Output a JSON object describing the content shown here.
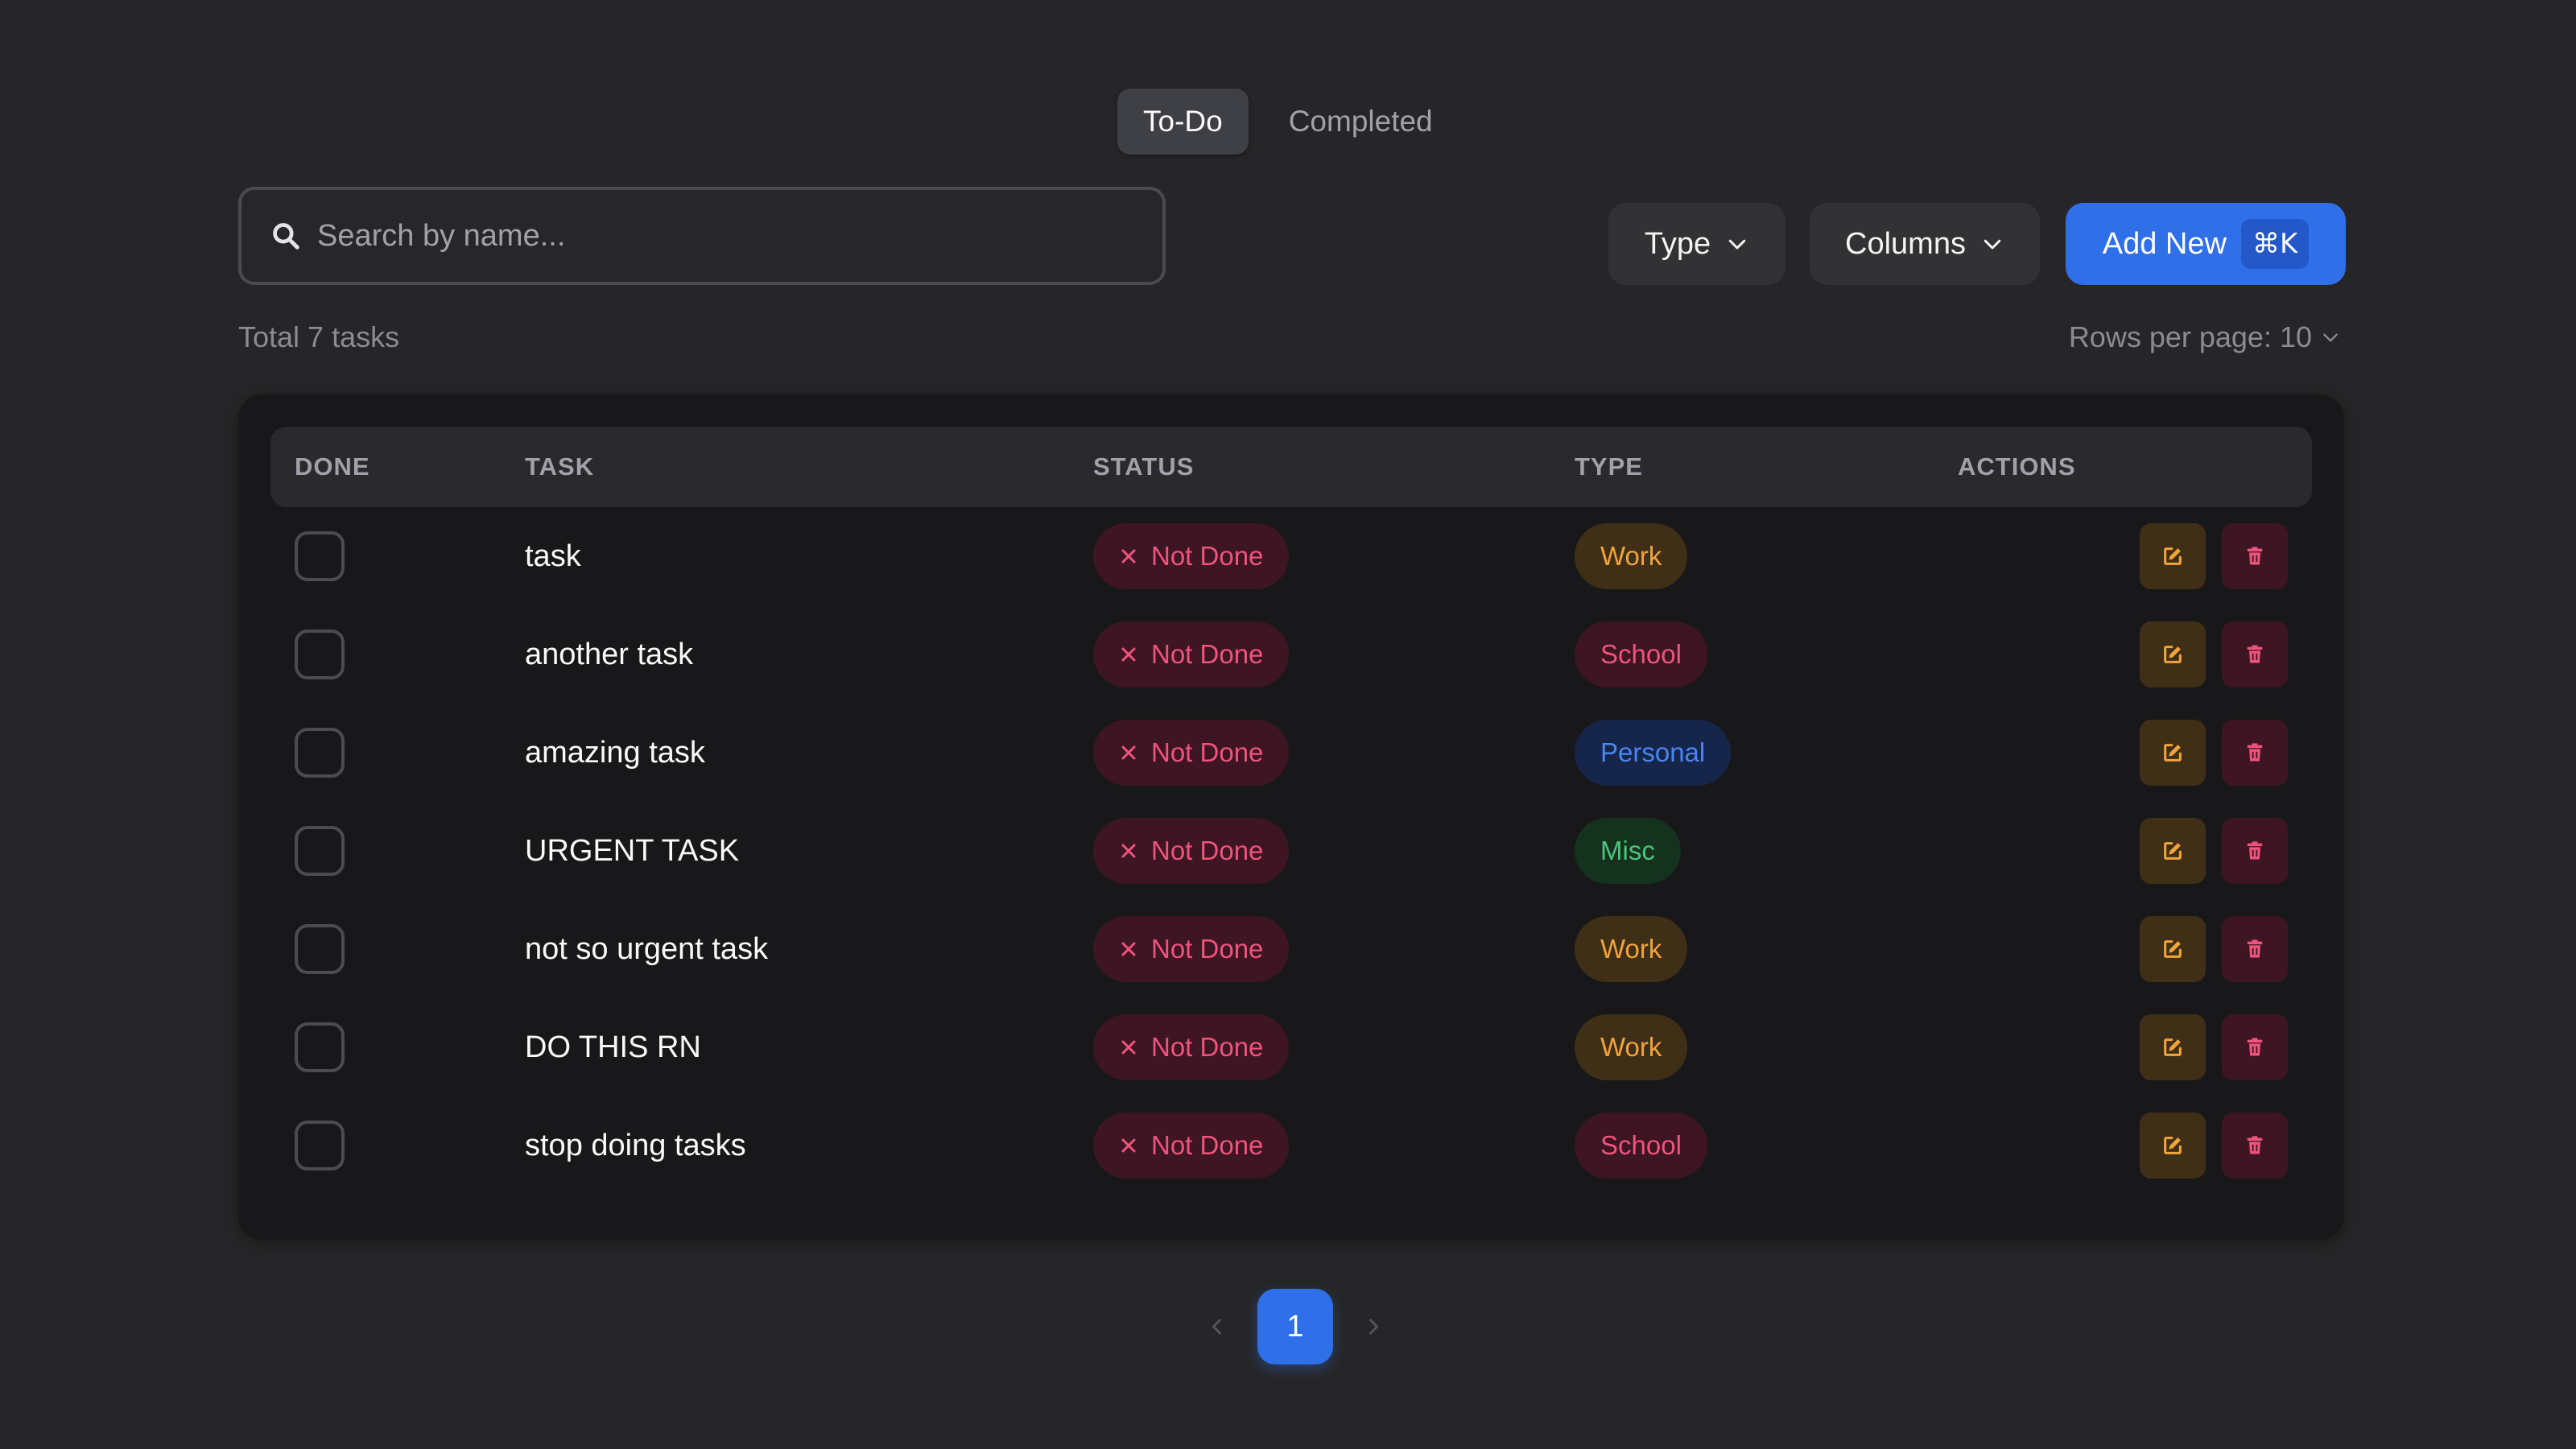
{
  "tabs": [
    {
      "label": "To-Do",
      "active": true
    },
    {
      "label": "Completed",
      "active": false
    }
  ],
  "search": {
    "placeholder": "Search by name...",
    "value": ""
  },
  "toolbar": {
    "type_label": "Type",
    "columns_label": "Columns",
    "add_label": "Add New",
    "add_shortcut": "⌘K"
  },
  "summary": {
    "total_text": "Total 7 tasks",
    "rows_per_page_text": "Rows per page: 10"
  },
  "table": {
    "headers": {
      "done": "DONE",
      "task": "TASK",
      "status": "STATUS",
      "type": "TYPE",
      "actions": "ACTIONS"
    },
    "rows": [
      {
        "task": "task",
        "status": "Not Done",
        "type": "Work",
        "type_kind": "work"
      },
      {
        "task": "another task",
        "status": "Not Done",
        "type": "School",
        "type_kind": "school"
      },
      {
        "task": "amazing task",
        "status": "Not Done",
        "type": "Personal",
        "type_kind": "personal"
      },
      {
        "task": "URGENT TASK",
        "status": "Not Done",
        "type": "Misc",
        "type_kind": "misc"
      },
      {
        "task": "not so urgent task",
        "status": "Not Done",
        "type": "Work",
        "type_kind": "work"
      },
      {
        "task": "DO THIS RN",
        "status": "Not Done",
        "type": "Work",
        "type_kind": "work"
      },
      {
        "task": "stop doing tasks",
        "status": "Not Done",
        "type": "School",
        "type_kind": "school"
      }
    ]
  },
  "pagination": {
    "current_page": "1"
  },
  "colors": {
    "background": "#262628",
    "card": "#18181a",
    "accent": "#2f6fe8",
    "status_not_done": "#f0537d",
    "work": "#f2a33c",
    "school": "#f0537d",
    "personal": "#4a86f0",
    "misc": "#4cc47a"
  },
  "icons": {
    "search": "search-icon",
    "chevron": "chevron-down-icon",
    "status": "x-icon",
    "edit": "edit-icon",
    "delete": "trash-icon",
    "prev": "chevron-left-icon",
    "next": "chevron-right-icon"
  }
}
